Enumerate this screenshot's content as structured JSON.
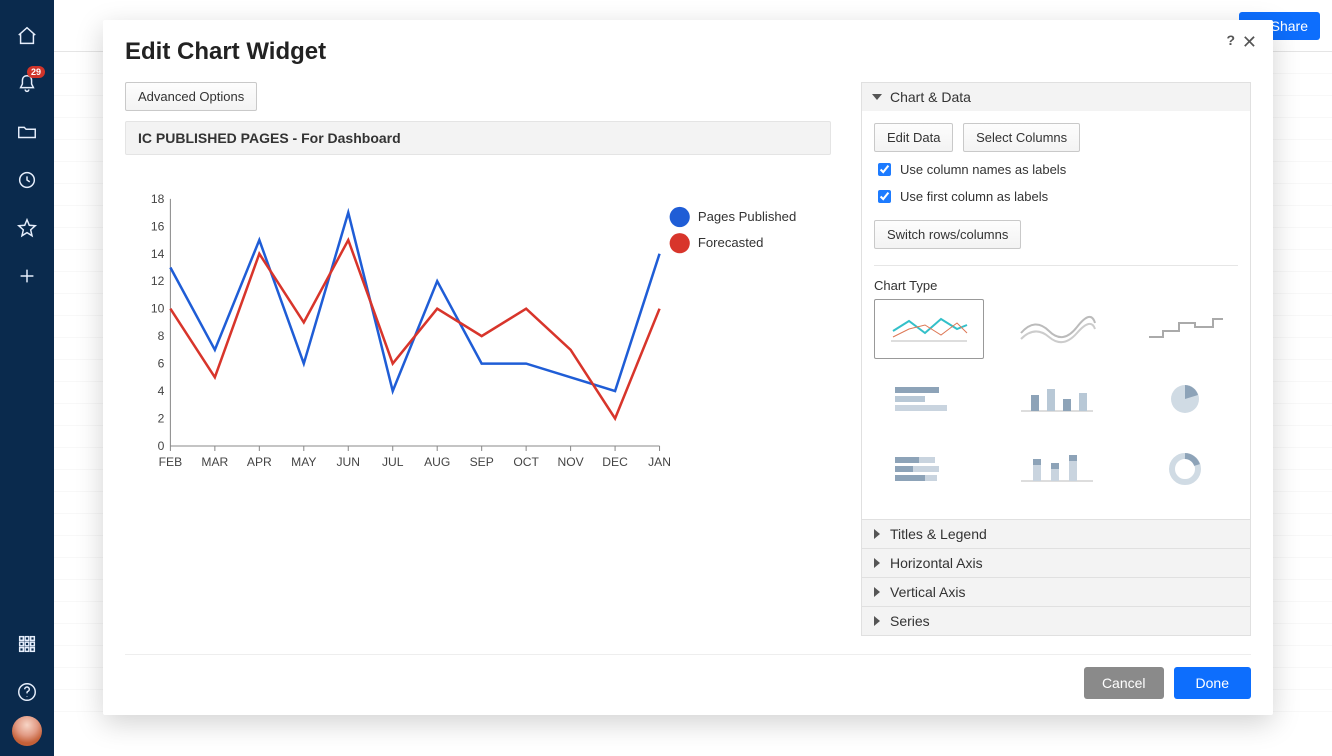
{
  "sidebar": {
    "notifications_badge": "29"
  },
  "header": {
    "share_label": "Share"
  },
  "modal": {
    "title": "Edit Chart Widget",
    "advanced_options_label": "Advanced Options",
    "chart_title": "IC PUBLISHED PAGES - For Dashboard",
    "cancel_label": "Cancel",
    "done_label": "Done"
  },
  "right": {
    "sections": {
      "chart_data": "Chart & Data",
      "titles_legend": "Titles & Legend",
      "horizontal_axis": "Horizontal Axis",
      "vertical_axis": "Vertical Axis",
      "series": "Series"
    },
    "edit_data_label": "Edit Data",
    "select_columns_label": "Select Columns",
    "use_column_names": "Use column names as labels",
    "use_first_column": "Use first column as labels",
    "switch_label": "Switch rows/columns",
    "chart_type_label": "Chart Type"
  },
  "chart_data": {
    "type": "line",
    "title": "IC PUBLISHED PAGES - For Dashboard",
    "xlabel": "",
    "ylabel": "",
    "xlim": null,
    "ylim": [
      0,
      18
    ],
    "yticks": [
      0,
      2,
      4,
      6,
      8,
      10,
      12,
      14,
      16,
      18
    ],
    "categories": [
      "FEB",
      "MAR",
      "APR",
      "MAY",
      "JUN",
      "JUL",
      "AUG",
      "SEP",
      "OCT",
      "NOV",
      "DEC",
      "JAN"
    ],
    "series": [
      {
        "name": "Pages Published",
        "color": "#1f5dd6",
        "values": [
          13,
          7,
          15,
          6,
          17,
          4,
          12,
          6,
          6,
          5,
          4,
          14
        ]
      },
      {
        "name": "Forecasted",
        "color": "#d8352b",
        "values": [
          10,
          5,
          14,
          9,
          15,
          6,
          10,
          8,
          10,
          7,
          2,
          10
        ]
      }
    ],
    "legend_position": "right"
  }
}
